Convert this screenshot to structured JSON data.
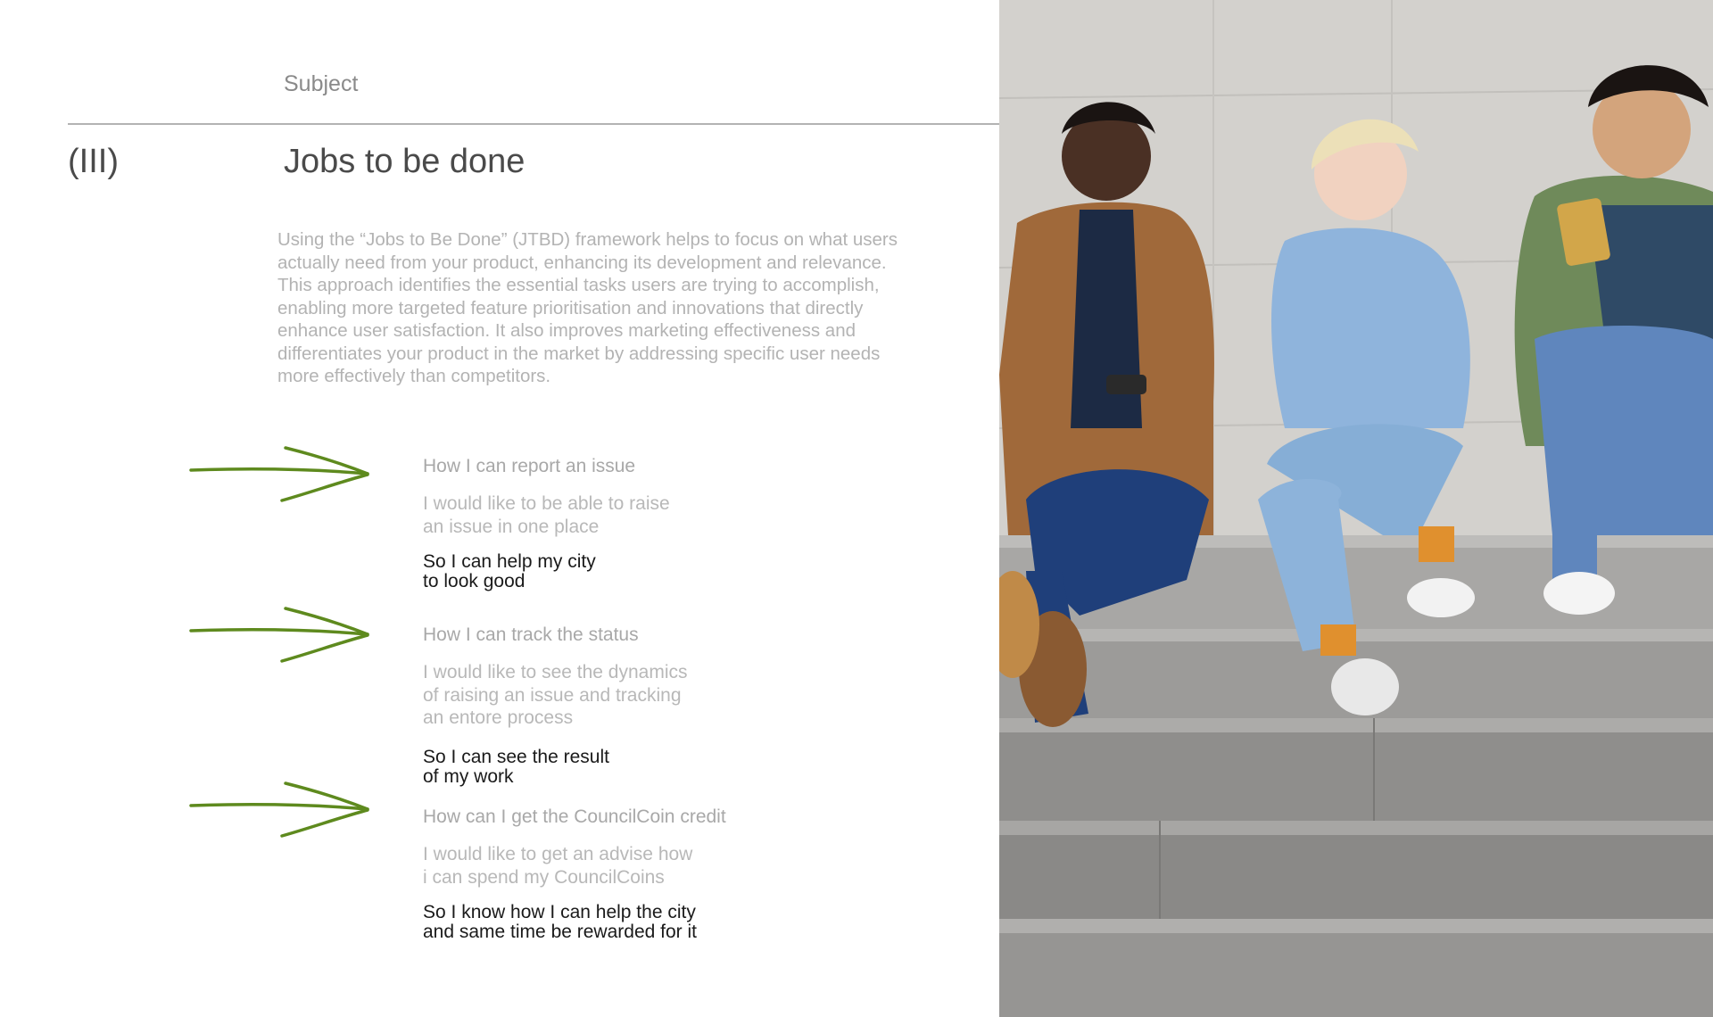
{
  "header": {
    "subject_label": "Subject",
    "section_number": "(III)",
    "title": "Jobs to be done"
  },
  "intro": "Using the “Jobs to Be Done” (JTBD) framework helps to focus on what users actually need from your product, enhancing its development and relevance. This approach identifies the essential tasks users are trying to accomplish, enabling more targeted feature prioritisation and innovations that directly enhance user satisfaction. It also improves marketing effectiveness and differentiates your product in the market by addressing specific user needs more effectively than competitors.",
  "jobs": [
    {
      "heading": "How I can report an issue",
      "desc_lines": [
        "I would like to be able to raise",
        "an issue in one place"
      ],
      "outcome_lines": [
        "So I can help my city",
        "to look good"
      ]
    },
    {
      "heading": "How I can track the status",
      "desc_lines": [
        "I would like to see the dynamics",
        "of raising an issue and tracking",
        "an entore process"
      ],
      "outcome_lines": [
        "So I can see the result",
        "of my work"
      ]
    },
    {
      "heading": "How can I get the CouncilCoin credit",
      "desc_lines": [
        "I would like to get an advise how",
        "i can spend my CouncilCoins"
      ],
      "outcome_lines": [
        "So I know how I can help the city",
        "and same time be rewarded for it"
      ]
    }
  ],
  "colors": {
    "arrow": "#5e8a1e",
    "heading": "#4a4a4a",
    "muted": "#b3b3b3",
    "outcome": "#1a1a1a"
  },
  "photo": {
    "icon": "group-of-students-on-steps-photo"
  }
}
